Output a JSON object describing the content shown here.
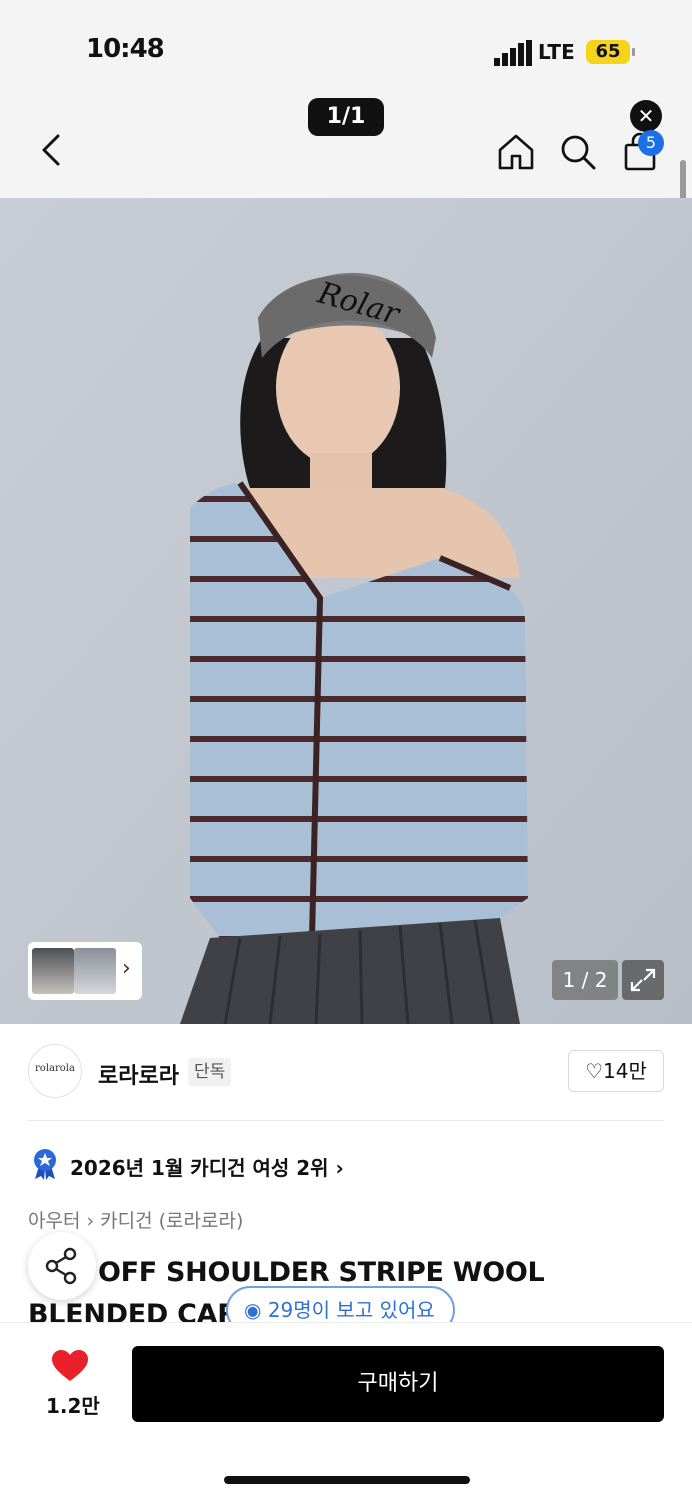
{
  "status_bar": {
    "time": "10:48",
    "network": "LTE",
    "battery": "65"
  },
  "header": {
    "pager": "1/1",
    "close_icon": "close-icon",
    "cart_count": "5"
  },
  "gallery": {
    "counter": "1 / 2"
  },
  "brand": {
    "logo_text": "rolarola",
    "name": "로라로라",
    "tag": "단독",
    "likes": "14만"
  },
  "ranking": {
    "text": "2026년 1월 카디건 여성 2위"
  },
  "breadcrumb": {
    "category": "아우터",
    "subcategory": "카디건",
    "brand_suffix": "(로라로라)"
  },
  "product": {
    "title": "OFF SHOULDER STRIPE WOOL BLENDED CARDIGAN [",
    "viewers": "29명이 보고 있어요"
  },
  "bottom_bar": {
    "fav_count": "1.2만",
    "buy_label": "구매하기"
  },
  "colors": {
    "accent_blue": "#1d6fe6",
    "heart_red": "#e8202a",
    "battery_yellow": "#f5d41a"
  }
}
